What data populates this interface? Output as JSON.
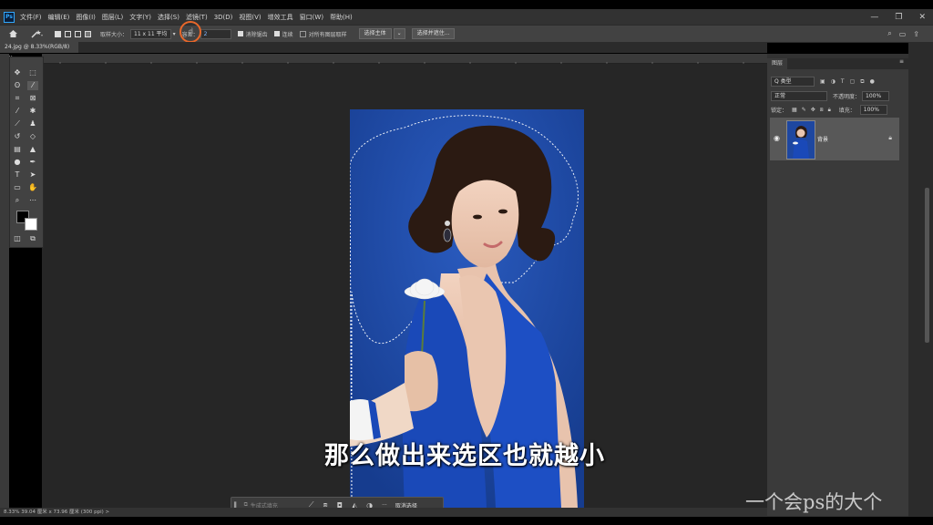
{
  "app": {
    "logo": "Ps"
  },
  "menu": [
    "文件(F)",
    "编辑(E)",
    "图像(I)",
    "图层(L)",
    "文字(Y)",
    "选择(S)",
    "滤镜(T)",
    "3D(D)",
    "视图(V)",
    "增效工具",
    "窗口(W)",
    "帮助(H)"
  ],
  "window_controls": {
    "minimize": "—",
    "restore": "❐",
    "close": "✕"
  },
  "options": {
    "sample_size_label": "取样大小：",
    "sample_size_value": "11 x 11 平均",
    "tolerance_label": "容差：",
    "tolerance_value": "2",
    "antialias_label": "消除锯齿",
    "contiguous_label": "连续",
    "sample_all_label": "对所有图层取样",
    "select_subject_label": "选择主体",
    "select_and_mask_label": "选择并遮住..."
  },
  "document": {
    "tab_title": "24.jpg @ 8.33%(RGB/8)",
    "tab_close": "✕"
  },
  "status": {
    "text": "8.33%   39.04 厘米 x 73.96 厘米 (300 ppi)   >"
  },
  "taskbar": {
    "placeholder": "生成式填充",
    "deselect_label": "取消选择",
    "more": "···"
  },
  "subtitle": "那么做出来选区也就越小",
  "layers_panel": {
    "title": "图层",
    "kind_label": "Q 类型",
    "blend_mode": "正常",
    "opacity_label": "不透明度：",
    "opacity_value": "100%",
    "lock_label": "锁定：",
    "fill_label": "填充：",
    "fill_value": "100%",
    "layer_name": "背景"
  },
  "watermark": "一个会ps的大个",
  "colors": {
    "accent": "#31a8ff",
    "photo_bg": "#1e47a0",
    "dress": "#1a49b8",
    "highlight_ring": "#e8672a"
  }
}
